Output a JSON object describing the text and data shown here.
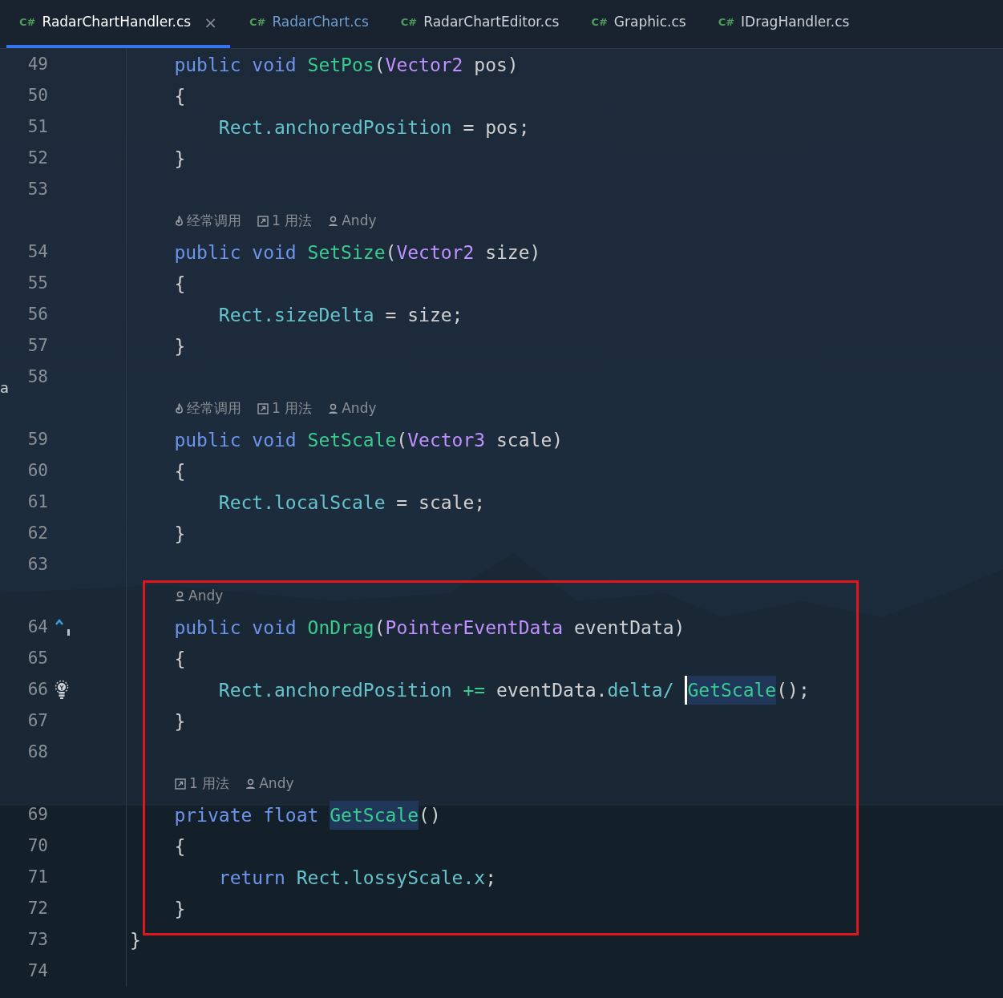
{
  "tabs": [
    {
      "file_type": "C#",
      "label": "RadarChartHandler.cs",
      "selected": true,
      "vcs_modified": false,
      "close": "×"
    },
    {
      "file_type": "C#",
      "label": "RadarChart.cs",
      "selected": false,
      "vcs_modified": true
    },
    {
      "file_type": "C#",
      "label": "RadarChartEditor.cs",
      "selected": false,
      "vcs_modified": false
    },
    {
      "file_type": "C#",
      "label": "Graphic.cs",
      "selected": false,
      "vcs_modified": false
    },
    {
      "file_type": "C#",
      "label": "IDragHandler.cs",
      "selected": false,
      "vcs_modified": false
    }
  ],
  "left_edge_fragment": "a",
  "rows": [
    {
      "kind": "code",
      "number": "49",
      "tokens": [
        {
          "text": "    public void",
          "kind": "keyword"
        },
        {
          "text": " SetPos",
          "kind": "method"
        },
        {
          "text": "(",
          "kind": "plain"
        },
        {
          "text": "Vector2",
          "kind": "type"
        },
        {
          "text": " pos)",
          "kind": "plain"
        }
      ]
    },
    {
      "kind": "code",
      "number": "50",
      "tokens": [
        {
          "text": "    {",
          "kind": "plain"
        }
      ]
    },
    {
      "kind": "code",
      "number": "51",
      "tokens": [
        {
          "text": "        Rect.anchoredPosition",
          "kind": "property"
        },
        {
          "text": " = pos;",
          "kind": "plain"
        }
      ]
    },
    {
      "kind": "code",
      "number": "52",
      "tokens": [
        {
          "text": "    }",
          "kind": "plain"
        }
      ]
    },
    {
      "kind": "code",
      "number": "53"
    },
    {
      "kind": "hint",
      "items": [
        {
          "kind": "hot",
          "text": "经常调用"
        },
        {
          "kind": "usages",
          "text": "1 用法"
        },
        {
          "kind": "author",
          "text": "Andy"
        }
      ]
    },
    {
      "kind": "code",
      "number": "54",
      "tokens": [
        {
          "text": "    public void",
          "kind": "keyword"
        },
        {
          "text": " SetSize",
          "kind": "method"
        },
        {
          "text": "(",
          "kind": "plain"
        },
        {
          "text": "Vector2",
          "kind": "type"
        },
        {
          "text": " size)",
          "kind": "plain"
        }
      ]
    },
    {
      "kind": "code",
      "number": "55",
      "tokens": [
        {
          "text": "    {",
          "kind": "plain"
        }
      ]
    },
    {
      "kind": "code",
      "number": "56",
      "tokens": [
        {
          "text": "        Rect.sizeDelta",
          "kind": "property"
        },
        {
          "text": " = size;",
          "kind": "plain"
        }
      ]
    },
    {
      "kind": "code",
      "number": "57",
      "tokens": [
        {
          "text": "    }",
          "kind": "plain"
        }
      ]
    },
    {
      "kind": "code",
      "number": "58"
    },
    {
      "kind": "hint",
      "items": [
        {
          "kind": "hot",
          "text": "经常调用"
        },
        {
          "kind": "usages",
          "text": "1 用法"
        },
        {
          "kind": "author",
          "text": "Andy"
        }
      ]
    },
    {
      "kind": "code",
      "number": "59",
      "tokens": [
        {
          "text": "    public void",
          "kind": "keyword"
        },
        {
          "text": " SetScale",
          "kind": "method"
        },
        {
          "text": "(",
          "kind": "plain"
        },
        {
          "text": "Vector3",
          "kind": "type"
        },
        {
          "text": " scale)",
          "kind": "plain"
        }
      ]
    },
    {
      "kind": "code",
      "number": "60",
      "tokens": [
        {
          "text": "    {",
          "kind": "plain"
        }
      ]
    },
    {
      "kind": "code",
      "number": "61",
      "tokens": [
        {
          "text": "        Rect.localScale",
          "kind": "property"
        },
        {
          "text": " = scale;",
          "kind": "plain"
        }
      ]
    },
    {
      "kind": "code",
      "number": "62",
      "tokens": [
        {
          "text": "    }",
          "kind": "plain"
        }
      ]
    },
    {
      "kind": "code",
      "number": "63"
    },
    {
      "kind": "hint",
      "items": [
        {
          "kind": "author",
          "text": "Andy"
        }
      ]
    },
    {
      "kind": "code",
      "number": "64",
      "gutter_icons": [
        {
          "kind": "implements"
        }
      ],
      "tokens": [
        {
          "text": "    public void",
          "kind": "keyword"
        },
        {
          "text": " OnDrag",
          "kind": "method"
        },
        {
          "text": "(",
          "kind": "plain"
        },
        {
          "text": "PointerEventData",
          "kind": "type"
        },
        {
          "text": " eventData)",
          "kind": "plain"
        }
      ]
    },
    {
      "kind": "code",
      "number": "65",
      "tokens": [
        {
          "text": "    {",
          "kind": "plain"
        }
      ]
    },
    {
      "kind": "code",
      "number": "66",
      "gutter_icons": [
        {
          "kind": "bulb"
        }
      ],
      "tokens": [
        {
          "text": "        Rect.anchoredPosition",
          "kind": "property"
        },
        {
          "text": " +=",
          "kind": "operator"
        },
        {
          "text": " eventData.",
          "kind": "plain"
        },
        {
          "text": "delta/",
          "kind": "property"
        },
        {
          "text": " GetScale",
          "kind": "method",
          "highlighted": true,
          "caret": true
        },
        {
          "text": "();",
          "kind": "plain"
        }
      ]
    },
    {
      "kind": "code",
      "number": "67",
      "tokens": [
        {
          "text": "    }",
          "kind": "plain"
        }
      ]
    },
    {
      "kind": "code",
      "number": "68"
    },
    {
      "kind": "hint",
      "items": [
        {
          "kind": "usages",
          "text": "1 用法"
        },
        {
          "kind": "author",
          "text": "Andy"
        }
      ]
    },
    {
      "kind": "code",
      "number": "69",
      "tokens": [
        {
          "text": "    private float",
          "kind": "keyword"
        },
        {
          "text": " GetScale",
          "kind": "method",
          "highlighted": true
        },
        {
          "text": "()",
          "kind": "plain"
        }
      ]
    },
    {
      "kind": "code",
      "number": "70",
      "tokens": [
        {
          "text": "    {",
          "kind": "plain"
        }
      ]
    },
    {
      "kind": "code",
      "number": "71",
      "tokens": [
        {
          "text": "        return",
          "kind": "keyword"
        },
        {
          "text": " Rect.lossyScale.x",
          "kind": "property"
        },
        {
          "text": ";",
          "kind": "plain"
        }
      ]
    },
    {
      "kind": "code",
      "number": "72",
      "tokens": [
        {
          "text": "    }",
          "kind": "plain"
        }
      ]
    },
    {
      "kind": "code",
      "number": "73",
      "tokens": [
        {
          "text": "}",
          "kind": "plain"
        }
      ]
    },
    {
      "kind": "code",
      "number": "74"
    }
  ]
}
